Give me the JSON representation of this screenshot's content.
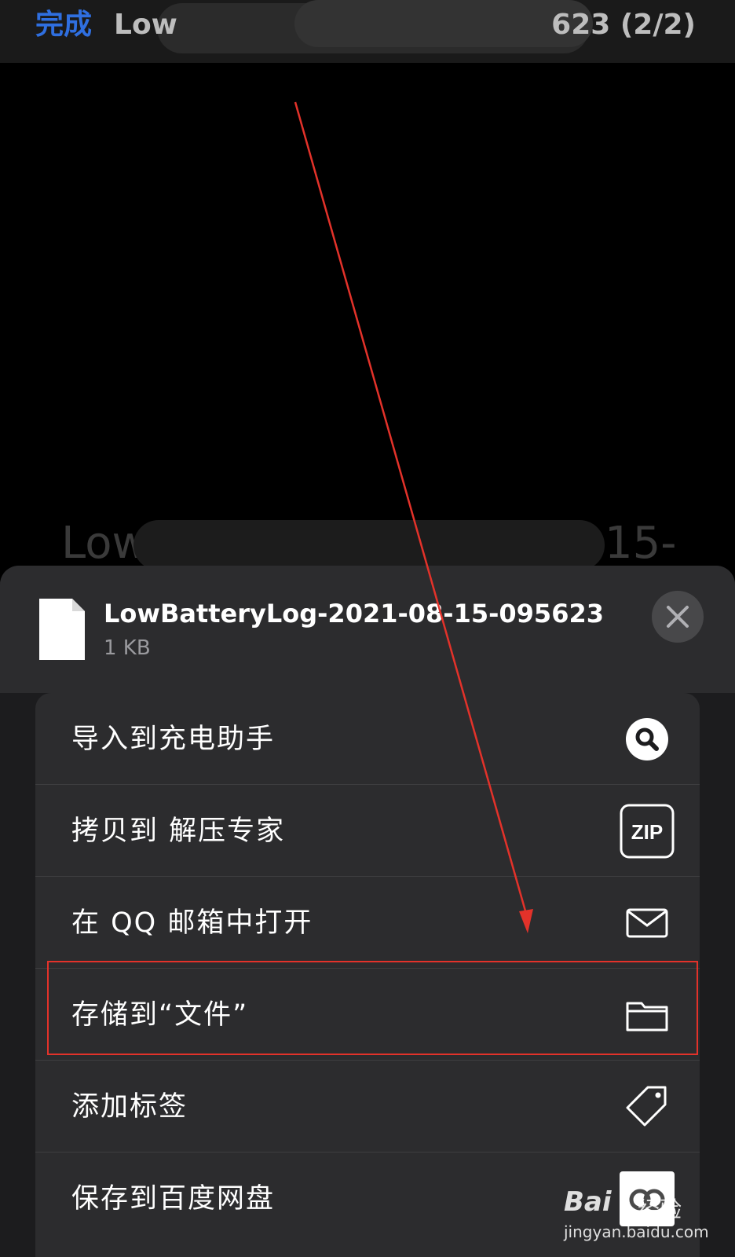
{
  "navbar": {
    "done_label": "完成",
    "title_left": "Low",
    "title_right": "623 (2/2)"
  },
  "preview": {
    "name_left": "Low",
    "name_right": "15-"
  },
  "sheet": {
    "file_name": "LowBatteryLog-2021-08-15-095623",
    "file_size": "1 KB",
    "actions": [
      {
        "label": "导入到充电助手",
        "icon": "search-icon"
      },
      {
        "label": "拷贝到 解压专家",
        "icon": "zip-icon",
        "icon_text": "ZIP"
      },
      {
        "label": "在 QQ 邮箱中打开",
        "icon": "mail-icon"
      },
      {
        "label": "存储到“文件”",
        "icon": "folder-icon"
      },
      {
        "label": "添加标签",
        "icon": "tag-icon"
      },
      {
        "label": "保存到百度网盘",
        "icon": "baidu-netdisk-icon"
      }
    ]
  },
  "watermark": {
    "brand": "Bai",
    "brand_suffix": "经验",
    "url": "jingyan.baidu.com"
  },
  "colors": {
    "accent": "#2f6fe0",
    "highlight": "#e3322a",
    "arrow": "#e3322a"
  }
}
